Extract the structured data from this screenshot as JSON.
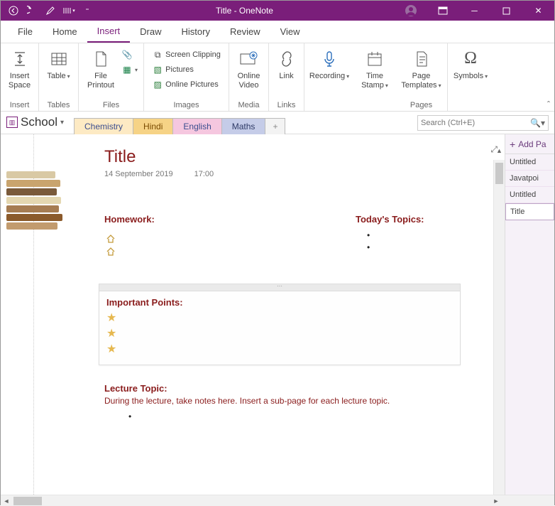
{
  "window": {
    "title": "Title  -  OneNote"
  },
  "menu": {
    "items": [
      "File",
      "Home",
      "Insert",
      "Draw",
      "History",
      "Review",
      "View"
    ],
    "active": 2
  },
  "ribbon": {
    "insert_space": "Insert\nSpace",
    "table": "Table",
    "file_printout": "File\nPrintout",
    "screen_clipping": "Screen Clipping",
    "pictures": "Pictures",
    "online_pictures": "Online Pictures",
    "online_video": "Online\nVideo",
    "link": "Link",
    "recording": "Recording",
    "time_stamp": "Time\nStamp",
    "page_templates": "Page\nTemplates",
    "symbols": "Symbols",
    "groups": {
      "insert": "Insert",
      "tables": "Tables",
      "files": "Files",
      "images": "Images",
      "media": "Media",
      "links": "Links",
      "pages": "Pages"
    }
  },
  "notebook": {
    "name": "School"
  },
  "tabs": {
    "chem": "Chemistry",
    "hindi": "Hindi",
    "eng": "English",
    "maths": "Maths",
    "add": "+"
  },
  "search": {
    "placeholder": "Search (Ctrl+E)"
  },
  "page": {
    "title": "Title",
    "date": "14 September 2019",
    "time": "17:00",
    "homework": "Homework:",
    "today": "Today's Topics:",
    "important": "Important Points:",
    "lecture_head": "Lecture Topic:",
    "lecture_body": "During the lecture, take notes here.  Insert a sub-page for each lecture topic."
  },
  "sidepanel": {
    "add": "Add Pa",
    "pages": [
      "Untitled",
      "Javatpoi",
      "Untitled",
      "Title"
    ],
    "active": 3
  }
}
